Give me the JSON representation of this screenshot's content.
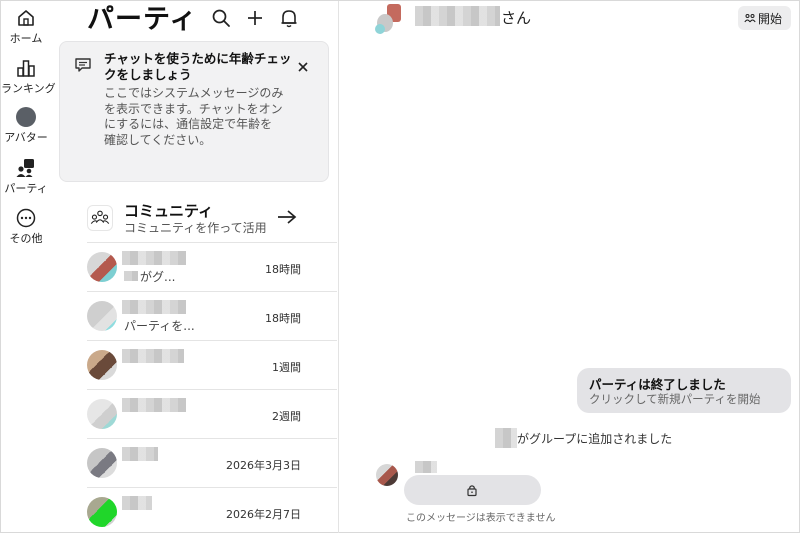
{
  "nav": {
    "items": [
      {
        "label": "ホーム",
        "icon": "home-icon"
      },
      {
        "label": "ランキング",
        "icon": "ranking-icon"
      },
      {
        "label": "アバター",
        "icon": "avatar"
      },
      {
        "label": "パーティ",
        "icon": "party-icon"
      },
      {
        "label": "その他",
        "icon": "more-icon"
      }
    ]
  },
  "party": {
    "title": "パーティ",
    "header_icons": [
      "search-icon",
      "add-icon",
      "bell-icon"
    ],
    "notice": {
      "title": "チャットを使うために年齢チェックをしましょう",
      "body": "ここではシステムメッセージのみを表示できます。チャットをオンにするには、通信設定で年齢を確認してください。",
      "close_icon": "close-icon"
    },
    "community": {
      "title": "コミュニティ",
      "subtitle": "コミュニティを作って活用"
    },
    "rows": [
      {
        "preview": "がグ...",
        "time": "18時間"
      },
      {
        "preview": "パーティを...",
        "time": "18時間"
      },
      {
        "preview": "",
        "time": "1週間"
      },
      {
        "preview": "",
        "time": "2週間"
      },
      {
        "preview": "",
        "time": "2026年3月3日"
      },
      {
        "preview": "",
        "time": "2026年2月7日"
      }
    ]
  },
  "chat": {
    "name_suffix": "さん",
    "start_label": "開始",
    "ended_card": {
      "title": "パーティは終了しました",
      "subtitle": "クリックして新規パーティを開始"
    },
    "system_message": "がグループに追加されました",
    "hidden_message_note": "このメッセージは表示できません"
  },
  "colors": {
    "notice_bg": "#f2f2f3",
    "bubble_bg": "#e3e3e6",
    "start_button_bg": "#ededee"
  }
}
